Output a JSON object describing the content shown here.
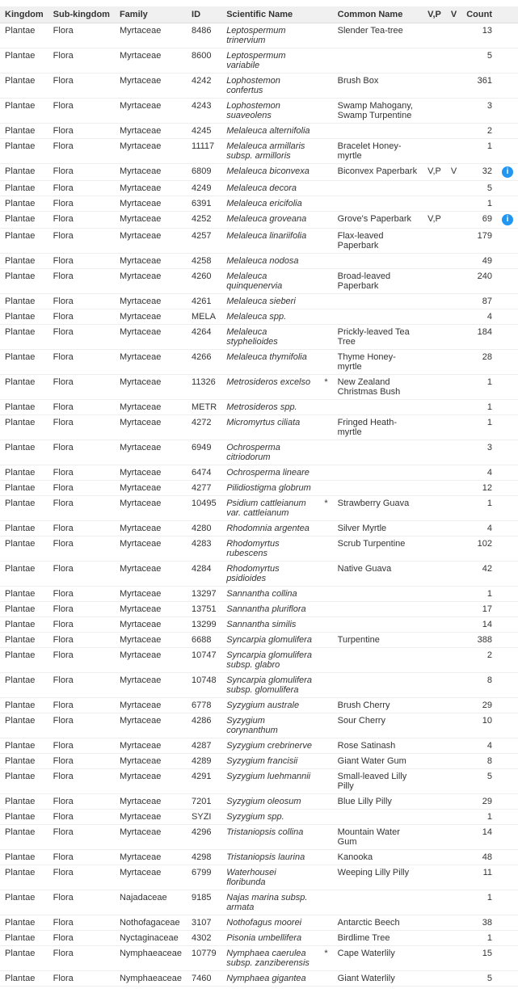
{
  "table": {
    "columns": [
      "Kingdom",
      "Sub-kingdom",
      "Family",
      "ID",
      "Scientific Name",
      "",
      "Common Name",
      "V,P",
      "V",
      "Count",
      ""
    ],
    "rows": [
      {
        "kingdom": "Plantae",
        "sub": "Flora",
        "family": "Myrtaceae",
        "id": "8486",
        "scientific": "Leptospermum trinervium",
        "asterisk": "",
        "common": "Slender Tea-tree",
        "vp": "",
        "v": "",
        "count": "13",
        "info": ""
      },
      {
        "kingdom": "Plantae",
        "sub": "Flora",
        "family": "Myrtaceae",
        "id": "8600",
        "scientific": "Leptospermum variabile",
        "asterisk": "",
        "common": "",
        "vp": "",
        "v": "",
        "count": "5",
        "info": ""
      },
      {
        "kingdom": "Plantae",
        "sub": "Flora",
        "family": "Myrtaceae",
        "id": "4242",
        "scientific": "Lophostemon confertus",
        "asterisk": "",
        "common": "Brush Box",
        "vp": "",
        "v": "",
        "count": "361",
        "info": ""
      },
      {
        "kingdom": "Plantae",
        "sub": "Flora",
        "family": "Myrtaceae",
        "id": "4243",
        "scientific": "Lophostemon suaveolens",
        "asterisk": "",
        "common": "Swamp Mahogany, Swamp Turpentine",
        "vp": "",
        "v": "",
        "count": "3",
        "info": ""
      },
      {
        "kingdom": "Plantae",
        "sub": "Flora",
        "family": "Myrtaceae",
        "id": "4245",
        "scientific": "Melaleuca alternifolia",
        "asterisk": "",
        "common": "",
        "vp": "",
        "v": "",
        "count": "2",
        "info": ""
      },
      {
        "kingdom": "Plantae",
        "sub": "Flora",
        "family": "Myrtaceae",
        "id": "11117",
        "scientific": "Melaleuca armillaris subsp. armilloris",
        "asterisk": "",
        "common": "Bracelet Honey-myrtle",
        "vp": "",
        "v": "",
        "count": "1",
        "info": ""
      },
      {
        "kingdom": "Plantae",
        "sub": "Flora",
        "family": "Myrtaceae",
        "id": "6809",
        "scientific": "Melaleuca biconvexa",
        "asterisk": "",
        "common": "Biconvex Paperbark",
        "vp": "V,P",
        "v": "V",
        "count": "32",
        "info": "i"
      },
      {
        "kingdom": "Plantae",
        "sub": "Flora",
        "family": "Myrtaceae",
        "id": "4249",
        "scientific": "Melaleuca decora",
        "asterisk": "",
        "common": "",
        "vp": "",
        "v": "",
        "count": "5",
        "info": ""
      },
      {
        "kingdom": "Plantae",
        "sub": "Flora",
        "family": "Myrtaceae",
        "id": "6391",
        "scientific": "Melaleuca ericifolia",
        "asterisk": "",
        "common": "",
        "vp": "",
        "v": "",
        "count": "1",
        "info": ""
      },
      {
        "kingdom": "Plantae",
        "sub": "Flora",
        "family": "Myrtaceae",
        "id": "4252",
        "scientific": "Melaleuca groveana",
        "asterisk": "",
        "common": "Grove's Paperbark",
        "vp": "V,P",
        "v": "",
        "count": "69",
        "info": "i"
      },
      {
        "kingdom": "Plantae",
        "sub": "Flora",
        "family": "Myrtaceae",
        "id": "4257",
        "scientific": "Melaleuca linariifolia",
        "asterisk": "",
        "common": "Flax-leaved Paperbark",
        "vp": "",
        "v": "",
        "count": "179",
        "info": ""
      },
      {
        "kingdom": "Plantae",
        "sub": "Flora",
        "family": "Myrtaceae",
        "id": "4258",
        "scientific": "Melaleuca nodosa",
        "asterisk": "",
        "common": "",
        "vp": "",
        "v": "",
        "count": "49",
        "info": ""
      },
      {
        "kingdom": "Plantae",
        "sub": "Flora",
        "family": "Myrtaceae",
        "id": "4260",
        "scientific": "Melaleuca quinquenervia",
        "asterisk": "",
        "common": "Broad-leaved Paperbark",
        "vp": "",
        "v": "",
        "count": "240",
        "info": ""
      },
      {
        "kingdom": "Plantae",
        "sub": "Flora",
        "family": "Myrtaceae",
        "id": "4261",
        "scientific": "Melaleuca sieberi",
        "asterisk": "",
        "common": "",
        "vp": "",
        "v": "",
        "count": "87",
        "info": ""
      },
      {
        "kingdom": "Plantae",
        "sub": "Flora",
        "family": "Myrtaceae",
        "id": "MELA",
        "scientific": "Melaleuca spp.",
        "asterisk": "",
        "common": "",
        "vp": "",
        "v": "",
        "count": "4",
        "info": ""
      },
      {
        "kingdom": "Plantae",
        "sub": "Flora",
        "family": "Myrtaceae",
        "id": "4264",
        "scientific": "Melaleuca styphelioides",
        "asterisk": "",
        "common": "Prickly-leaved Tea Tree",
        "vp": "",
        "v": "",
        "count": "184",
        "info": ""
      },
      {
        "kingdom": "Plantae",
        "sub": "Flora",
        "family": "Myrtaceae",
        "id": "4266",
        "scientific": "Melaleuca thymifolia",
        "asterisk": "",
        "common": "Thyme Honey-myrtle",
        "vp": "",
        "v": "",
        "count": "28",
        "info": ""
      },
      {
        "kingdom": "Plantae",
        "sub": "Flora",
        "family": "Myrtaceae",
        "id": "11326",
        "scientific": "Metrosideros excelso",
        "asterisk": "*",
        "common": "New Zealand Christmas Bush",
        "vp": "",
        "v": "",
        "count": "1",
        "info": ""
      },
      {
        "kingdom": "Plantae",
        "sub": "Flora",
        "family": "Myrtaceae",
        "id": "METR",
        "scientific": "Metrosideros spp.",
        "asterisk": "",
        "common": "",
        "vp": "",
        "v": "",
        "count": "1",
        "info": ""
      },
      {
        "kingdom": "Plantae",
        "sub": "Flora",
        "family": "Myrtaceae",
        "id": "4272",
        "scientific": "Micromyrtus ciliata",
        "asterisk": "",
        "common": "Fringed Heath-myrtle",
        "vp": "",
        "v": "",
        "count": "1",
        "info": ""
      },
      {
        "kingdom": "Plantae",
        "sub": "Flora",
        "family": "Myrtaceae",
        "id": "6949",
        "scientific": "Ochrosperma citriodorum",
        "asterisk": "",
        "common": "",
        "vp": "",
        "v": "",
        "count": "3",
        "info": ""
      },
      {
        "kingdom": "Plantae",
        "sub": "Flora",
        "family": "Myrtaceae",
        "id": "6474",
        "scientific": "Ochrosperma lineare",
        "asterisk": "",
        "common": "",
        "vp": "",
        "v": "",
        "count": "4",
        "info": ""
      },
      {
        "kingdom": "Plantae",
        "sub": "Flora",
        "family": "Myrtaceae",
        "id": "4277",
        "scientific": "Pilidiostigma globrum",
        "asterisk": "",
        "common": "",
        "vp": "",
        "v": "",
        "count": "12",
        "info": ""
      },
      {
        "kingdom": "Plantae",
        "sub": "Flora",
        "family": "Myrtaceae",
        "id": "10495",
        "scientific": "Psidium cattleianum var. cattleianum",
        "asterisk": "*",
        "common": "Strawberry Guava",
        "vp": "",
        "v": "",
        "count": "1",
        "info": ""
      },
      {
        "kingdom": "Plantae",
        "sub": "Flora",
        "family": "Myrtaceae",
        "id": "4280",
        "scientific": "Rhodomnia argentea",
        "asterisk": "",
        "common": "Silver Myrtle",
        "vp": "",
        "v": "",
        "count": "4",
        "info": ""
      },
      {
        "kingdom": "Plantae",
        "sub": "Flora",
        "family": "Myrtaceae",
        "id": "4283",
        "scientific": "Rhodomyrtus rubescens",
        "asterisk": "",
        "common": "Scrub Turpentine",
        "vp": "",
        "v": "",
        "count": "102",
        "info": ""
      },
      {
        "kingdom": "Plantae",
        "sub": "Flora",
        "family": "Myrtaceae",
        "id": "4284",
        "scientific": "Rhodomyrtus psidioides",
        "asterisk": "",
        "common": "Native Guava",
        "vp": "",
        "v": "",
        "count": "42",
        "info": ""
      },
      {
        "kingdom": "Plantae",
        "sub": "Flora",
        "family": "Myrtaceae",
        "id": "13297",
        "scientific": "Sannantha collina",
        "asterisk": "",
        "common": "",
        "vp": "",
        "v": "",
        "count": "1",
        "info": ""
      },
      {
        "kingdom": "Plantae",
        "sub": "Flora",
        "family": "Myrtaceae",
        "id": "13751",
        "scientific": "Sannantha pluriflora",
        "asterisk": "",
        "common": "",
        "vp": "",
        "v": "",
        "count": "17",
        "info": ""
      },
      {
        "kingdom": "Plantae",
        "sub": "Flora",
        "family": "Myrtaceae",
        "id": "13299",
        "scientific": "Sannantha similis",
        "asterisk": "",
        "common": "",
        "vp": "",
        "v": "",
        "count": "14",
        "info": ""
      },
      {
        "kingdom": "Plantae",
        "sub": "Flora",
        "family": "Myrtaceae",
        "id": "6688",
        "scientific": "Syncarpia glomulifera",
        "asterisk": "",
        "common": "Turpentine",
        "vp": "",
        "v": "",
        "count": "388",
        "info": ""
      },
      {
        "kingdom": "Plantae",
        "sub": "Flora",
        "family": "Myrtaceae",
        "id": "10747",
        "scientific": "Syncarpia glomulifera subsp. glabro",
        "asterisk": "",
        "common": "",
        "vp": "",
        "v": "",
        "count": "2",
        "info": ""
      },
      {
        "kingdom": "Plantae",
        "sub": "Flora",
        "family": "Myrtaceae",
        "id": "10748",
        "scientific": "Syncarpia glomulifera subsp. glomulifera",
        "asterisk": "",
        "common": "",
        "vp": "",
        "v": "",
        "count": "8",
        "info": ""
      },
      {
        "kingdom": "Plantae",
        "sub": "Flora",
        "family": "Myrtaceae",
        "id": "6778",
        "scientific": "Syzygium australe",
        "asterisk": "",
        "common": "Brush Cherry",
        "vp": "",
        "v": "",
        "count": "29",
        "info": ""
      },
      {
        "kingdom": "Plantae",
        "sub": "Flora",
        "family": "Myrtaceae",
        "id": "4286",
        "scientific": "Syzygium corynanthum",
        "asterisk": "",
        "common": "Sour Cherry",
        "vp": "",
        "v": "",
        "count": "10",
        "info": ""
      },
      {
        "kingdom": "Plantae",
        "sub": "Flora",
        "family": "Myrtaceae",
        "id": "4287",
        "scientific": "Syzygium crebrinerve",
        "asterisk": "",
        "common": "Rose Satinash",
        "vp": "",
        "v": "",
        "count": "4",
        "info": ""
      },
      {
        "kingdom": "Plantae",
        "sub": "Flora",
        "family": "Myrtaceae",
        "id": "4289",
        "scientific": "Syzygium francisii",
        "asterisk": "",
        "common": "Giant Water Gum",
        "vp": "",
        "v": "",
        "count": "8",
        "info": ""
      },
      {
        "kingdom": "Plantae",
        "sub": "Flora",
        "family": "Myrtaceae",
        "id": "4291",
        "scientific": "Syzygium luehmannii",
        "asterisk": "",
        "common": "Small-leaved Lilly Pilly",
        "vp": "",
        "v": "",
        "count": "5",
        "info": ""
      },
      {
        "kingdom": "Plantae",
        "sub": "Flora",
        "family": "Myrtaceae",
        "id": "7201",
        "scientific": "Syzygium oleosum",
        "asterisk": "",
        "common": "Blue Lilly Pilly",
        "vp": "",
        "v": "",
        "count": "29",
        "info": ""
      },
      {
        "kingdom": "Plantae",
        "sub": "Flora",
        "family": "Myrtaceae",
        "id": "SYZI",
        "scientific": "Syzygium spp.",
        "asterisk": "",
        "common": "",
        "vp": "",
        "v": "",
        "count": "1",
        "info": ""
      },
      {
        "kingdom": "Plantae",
        "sub": "Flora",
        "family": "Myrtaceae",
        "id": "4296",
        "scientific": "Tristaniopsis collina",
        "asterisk": "",
        "common": "Mountain Water Gum",
        "vp": "",
        "v": "",
        "count": "14",
        "info": ""
      },
      {
        "kingdom": "Plantae",
        "sub": "Flora",
        "family": "Myrtaceae",
        "id": "4298",
        "scientific": "Tristaniopsis laurina",
        "asterisk": "",
        "common": "Kanooka",
        "vp": "",
        "v": "",
        "count": "48",
        "info": ""
      },
      {
        "kingdom": "Plantae",
        "sub": "Flora",
        "family": "Myrtaceae",
        "id": "6799",
        "scientific": "Waterhousei floribunda",
        "asterisk": "",
        "common": "Weeping Lilly Pilly",
        "vp": "",
        "v": "",
        "count": "11",
        "info": ""
      },
      {
        "kingdom": "Plantae",
        "sub": "Flora",
        "family": "Najadaceae",
        "id": "9185",
        "scientific": "Najas marina subsp. armata",
        "asterisk": "",
        "common": "",
        "vp": "",
        "v": "",
        "count": "1",
        "info": ""
      },
      {
        "kingdom": "Plantae",
        "sub": "Flora",
        "family": "Nothofagaceae",
        "id": "3107",
        "scientific": "Nothofagus moorei",
        "asterisk": "",
        "common": "Antarctic Beech",
        "vp": "",
        "v": "",
        "count": "38",
        "info": ""
      },
      {
        "kingdom": "Plantae",
        "sub": "Flora",
        "family": "Nyctaginaceae",
        "id": "4302",
        "scientific": "Pisonia umbellifera",
        "asterisk": "",
        "common": "Birdlime Tree",
        "vp": "",
        "v": "",
        "count": "1",
        "info": ""
      },
      {
        "kingdom": "Plantae",
        "sub": "Flora",
        "family": "Nymphaeaceae",
        "id": "10779",
        "scientific": "Nymphaea caerulea subsp. zanziberensis",
        "asterisk": "*",
        "common": "Cape Waterlily",
        "vp": "",
        "v": "",
        "count": "15",
        "info": ""
      },
      {
        "kingdom": "Plantae",
        "sub": "Flora",
        "family": "Nymphaeaceae",
        "id": "7460",
        "scientific": "Nymphaea gigantea",
        "asterisk": "",
        "common": "Giant Waterlily",
        "vp": "",
        "v": "",
        "count": "5",
        "info": ""
      }
    ]
  }
}
